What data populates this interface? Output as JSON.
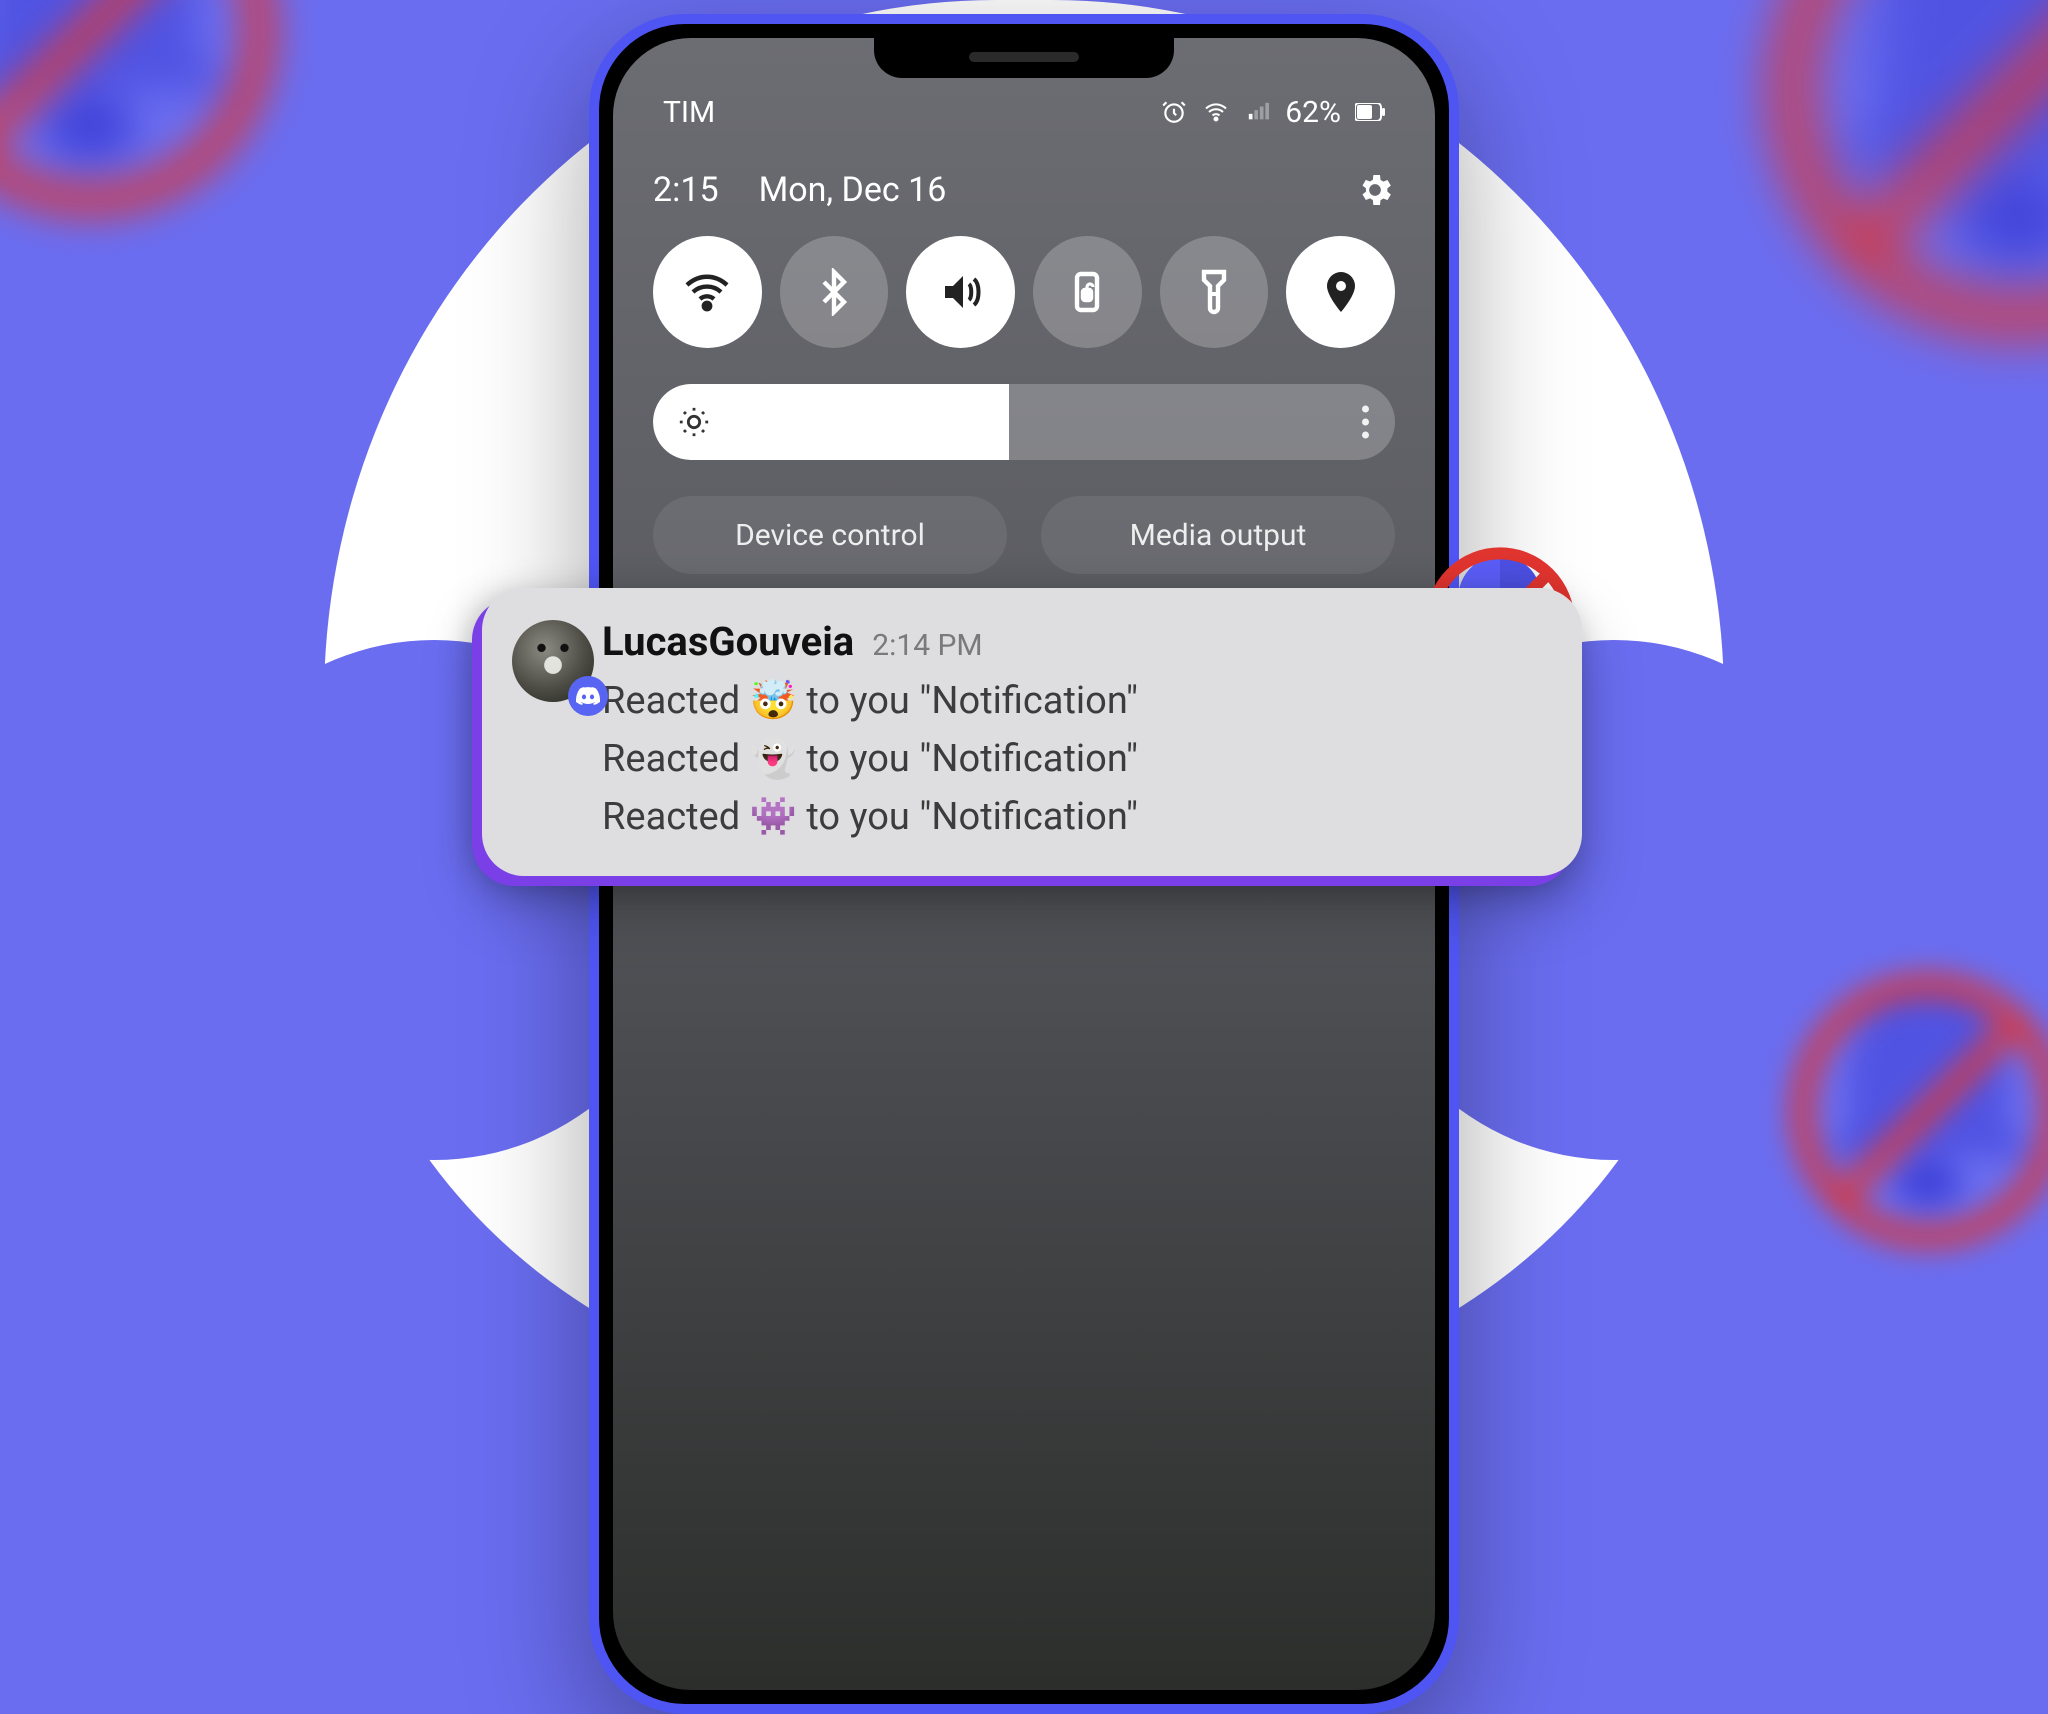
{
  "colors": {
    "bg": "#6a6df0",
    "accent": "#5865f2",
    "prohibit": "#e0342f"
  },
  "statusbar": {
    "carrier": "TIM",
    "battery_pct": "62%",
    "icons": [
      "alarm-icon",
      "wifi-icon",
      "signal-icon",
      "battery-icon"
    ]
  },
  "qs": {
    "time": "2:15",
    "date": "Mon, Dec 16",
    "settings_label": "Settings",
    "toggles": [
      {
        "name": "wifi-toggle",
        "on": true
      },
      {
        "name": "bluetooth-toggle",
        "on": false
      },
      {
        "name": "sound-toggle",
        "on": true
      },
      {
        "name": "rotation-lock-toggle",
        "on": false
      },
      {
        "name": "flashlight-toggle",
        "on": false
      },
      {
        "name": "location-toggle",
        "on": true
      }
    ],
    "brightness_pct": 48,
    "buttons": {
      "device_control": "Device control",
      "media_output": "Media output"
    }
  },
  "notification": {
    "app": "Discord",
    "user": "LucasGouveia",
    "time": "2:14 PM",
    "lines": [
      {
        "prefix": "Reacted ",
        "emoji": "🤯",
        "suffix": " to you \"Notification\""
      },
      {
        "prefix": "Reacted ",
        "emoji": "👻",
        "suffix": " to you \"Notification\""
      },
      {
        "prefix": "Reacted ",
        "emoji": "👾",
        "suffix": " to you \"Notification\""
      }
    ]
  },
  "decor": {
    "label": "notifications-muted-bell"
  }
}
